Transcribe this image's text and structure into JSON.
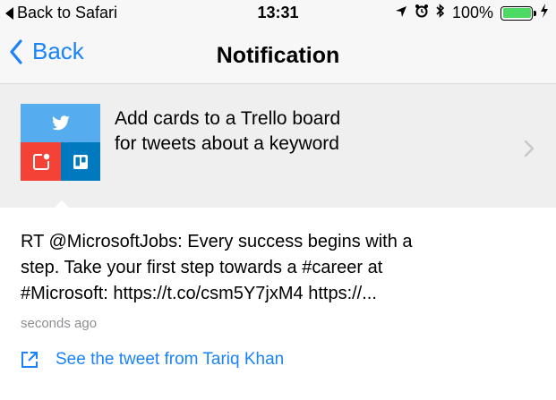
{
  "status_bar": {
    "back_label": "Back to Safari",
    "time": "13:31",
    "battery_percent": "100%",
    "battery_level": 1.0,
    "icons": [
      "location-arrow-icon",
      "alarm-clock-icon",
      "bluetooth-icon",
      "battery-icon",
      "charging-bolt-icon"
    ]
  },
  "nav": {
    "back_label": "Back",
    "title": "Notification"
  },
  "applet": {
    "line1": "Add cards to a Trello board",
    "line2": "for tweets about a keyword",
    "icons": [
      "twitter-icon",
      "notification-icon",
      "trello-icon"
    ],
    "colors": {
      "twitter": "#55acee",
      "notification": "#f44336",
      "trello": "#0079bf"
    }
  },
  "tweet": {
    "line1": "RT @MicrosoftJobs: Every success begins with a",
    "line2": "step. Take your first step towards a #career at",
    "line3": "#Microsoft: https://t.co/csm5Y7jxM4 https://...",
    "timestamp": "seconds ago",
    "link_label": "See the tweet from Tariq Khan"
  },
  "colors": {
    "accent": "#1a82fb",
    "battery": "#4cd964"
  }
}
